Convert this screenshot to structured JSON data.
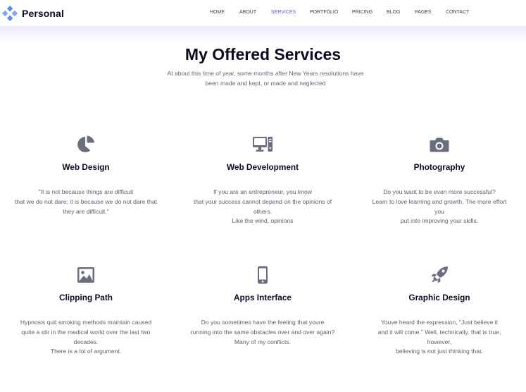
{
  "brand": {
    "name": "Personal"
  },
  "nav": {
    "items": [
      {
        "label": "HOME",
        "active": false
      },
      {
        "label": "ABOUT",
        "active": false
      },
      {
        "label": "SERVICES",
        "active": true
      },
      {
        "label": "PORTFOLIO",
        "active": false
      },
      {
        "label": "PRICING",
        "active": false
      },
      {
        "label": "BLOG",
        "active": false
      },
      {
        "label": "PAGES",
        "active": false
      },
      {
        "label": "CONTACT",
        "active": false
      }
    ]
  },
  "hero": {
    "title": "My Offered Services",
    "subtitle_line1": "At about this time of year, some months after New Years resolutions have",
    "subtitle_line2": "been made and kept, or made and neglected"
  },
  "services": [
    {
      "icon": "pie-chart-icon",
      "title": "Web Design",
      "lines": [
        "\"It is not because things are difficult",
        "that we do not dare; it is because we do not dare that",
        "they are difficult.\""
      ]
    },
    {
      "icon": "desktop-computer-icon",
      "title": "Web Development",
      "lines": [
        "If you are an entrepreneur, you know",
        "that your success cannot depend on the opinions of",
        "others.",
        "Like the wind, opinions"
      ]
    },
    {
      "icon": "camera-icon",
      "title": "Photography",
      "lines": [
        "Do you want to be even more successful?",
        "Learn to love learning and growth. The more effort",
        "you",
        "put into improving your skills."
      ]
    },
    {
      "icon": "image-icon",
      "title": "Clipping Path",
      "lines": [
        "Hypnosis quit smoking methods maintain caused",
        "quite a stir in the medical world over the last two",
        "decades.",
        "There is a lot of argument."
      ]
    },
    {
      "icon": "mobile-phone-icon",
      "title": "Apps Interface",
      "lines": [
        "Do you sometimes have the feeling that youre",
        "running into the same obstacles over and over again?",
        "Many of my conflicts."
      ]
    },
    {
      "icon": "rocket-icon",
      "title": "Graphic Design",
      "lines": [
        "Youve heard the expression, \"Just believe it",
        "and it will come.\" Well, technically, that is true,",
        "however,",
        "believing is not just thinking that."
      ]
    }
  ],
  "colors": {
    "accent": "#5b5fd6",
    "icon": "#6b6e80",
    "logo": "#5b8ef0",
    "heading": "#0b0c1f"
  }
}
